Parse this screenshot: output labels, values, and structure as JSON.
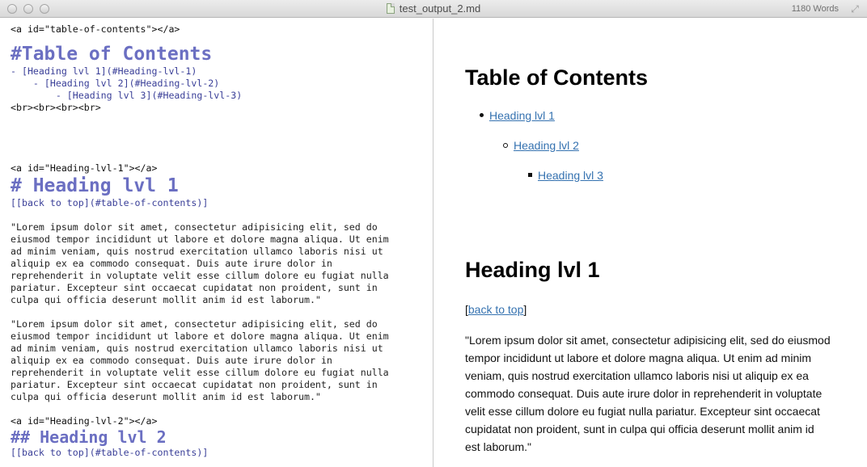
{
  "window": {
    "title": "test_output_2.md",
    "word_count": "1180 Words"
  },
  "editor": {
    "lines": {
      "anchor_toc": "<a id=\"table-of-contents\"></a>",
      "toc_heading": "#Table of Contents",
      "toc_item_1": "- [Heading lvl 1](#Heading-lvl-1)",
      "toc_item_2": "    - [Heading lvl 2](#Heading-lvl-2)",
      "toc_item_3": "        - [Heading lvl 3](#Heading-lvl-3)",
      "breaks": "<br><br><br><br>",
      "anchor_h1": "<a id=\"Heading-lvl-1\"></a>",
      "h1": "# Heading lvl 1",
      "back_top_1": "[[back to top](#table-of-contents)]",
      "para1": [
        "\"Lorem ipsum dolor sit amet, consectetur adipisicing elit, sed do",
        "eiusmod tempor incididunt ut labore et dolore magna aliqua. Ut enim",
        "ad minim veniam, quis nostrud exercitation ullamco laboris nisi ut",
        "aliquip ex ea commodo consequat. Duis aute irure dolor in",
        "reprehenderit in voluptate velit esse cillum dolore eu fugiat nulla",
        "pariatur. Excepteur sint occaecat cupidatat non proident, sunt in",
        "culpa qui officia deserunt mollit anim id est laborum.\""
      ],
      "para2": [
        "\"Lorem ipsum dolor sit amet, consectetur adipisicing elit, sed do",
        "eiusmod tempor incididunt ut labore et dolore magna aliqua. Ut enim",
        "ad minim veniam, quis nostrud exercitation ullamco laboris nisi ut",
        "aliquip ex ea commodo consequat. Duis aute irure dolor in",
        "reprehenderit in voluptate velit esse cillum dolore eu fugiat nulla",
        "pariatur. Excepteur sint occaecat cupidatat non proident, sunt in",
        "culpa qui officia deserunt mollit anim id est laborum.\""
      ],
      "anchor_h2": "<a id=\"Heading-lvl-2\"></a>",
      "h2": "## Heading lvl 2",
      "back_top_2": "[[back to top](#table-of-contents)]"
    }
  },
  "preview": {
    "toc_title": "Table of Contents",
    "toc_items": [
      "Heading lvl 1",
      "Heading lvl 2",
      "Heading lvl 3"
    ],
    "h1": "Heading lvl 1",
    "back_open": "[",
    "back_link": "back to top",
    "back_close": "]",
    "paragraph": "\"Lorem ipsum dolor sit amet, consectetur adipisicing elit, sed do eiusmod tempor incididunt ut labore et dolore magna aliqua. Ut enim ad minim veniam, quis nostrud exercitation ullamco laboris nisi ut aliquip ex ea commodo consequat. Duis aute irure dolor in reprehenderit in voluptate velit esse cillum dolore eu fugiat nulla pariatur. Excepteur sint occaecat cupidatat non proident, sunt in culpa qui officia deserunt mollit anim id est laborum.\""
  },
  "colors": {
    "heading_markdown": "#6b6fc2",
    "link_markdown": "#3a3f98",
    "preview_link": "#3572b0"
  }
}
